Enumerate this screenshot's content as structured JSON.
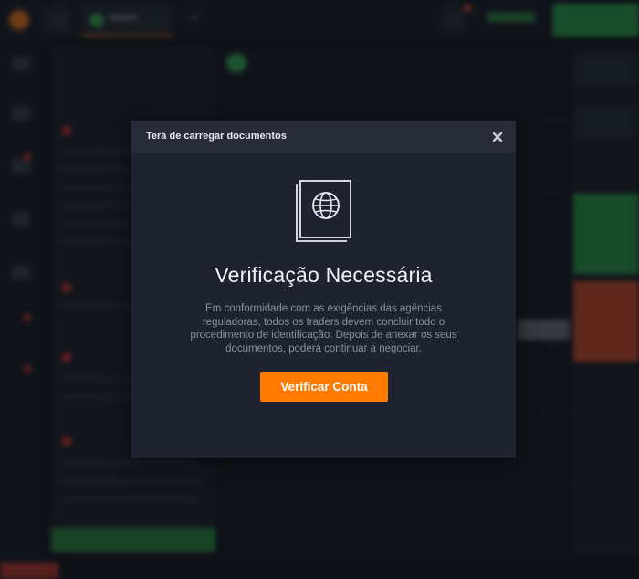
{
  "modal": {
    "title": "Terá de carregar documentos",
    "heading": "Verificação Necessária",
    "description": "Em conformidade com as exigências das agências reguladoras, todos os traders devem concluir todo o procedimento de identificação. Depois de anexar os seus documentos, poderá continuar a negociar.",
    "verify_button_label": "Verificar Conta",
    "close_icon": "close-icon",
    "illustration_icon": "passport-globe-icon"
  },
  "colors": {
    "accent": "#ff7a00",
    "modal_bg": "#1f2331",
    "modal_header_bg": "#272b3a",
    "background": "#151820"
  }
}
